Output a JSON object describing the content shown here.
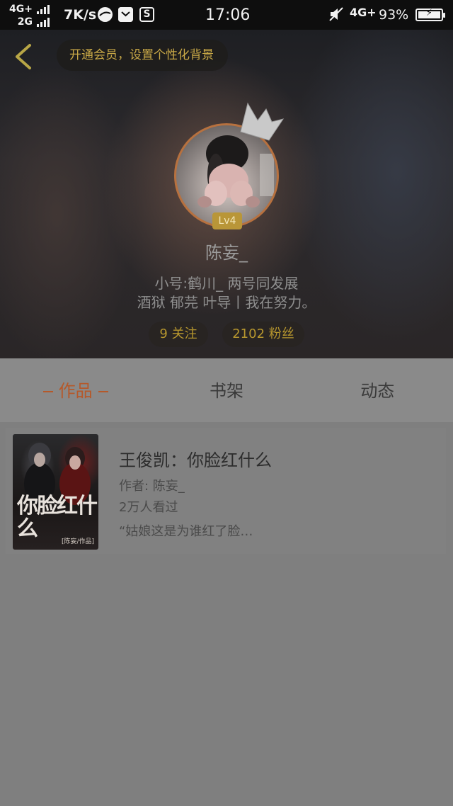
{
  "status_bar": {
    "net1": "4G+",
    "net2": "2G",
    "speed": "7K/s",
    "time": "17:06",
    "net_right": "4G+",
    "battery_pct": "93%",
    "notif_icons": [
      "browser-icon",
      "mail-icon",
      "s-app-icon"
    ],
    "s_glyph": "S"
  },
  "header": {
    "vip_banner": "开通会员，设置个性化背景",
    "level": "Lv4",
    "username": "陈妄_",
    "bio_line1": "小号:鹤川_  两号同发展",
    "bio_line2": "酒狱 郁芫 叶导丨我在努力。",
    "following": "9 关注",
    "fans": "2102 粉丝"
  },
  "tabs": [
    {
      "label": "作品",
      "active": true
    },
    {
      "label": "书架",
      "active": false
    },
    {
      "label": "动态",
      "active": false
    }
  ],
  "work": {
    "title": "王俊凯：你脸红什么",
    "author": "作者: 陈妄_",
    "reads": "2万人看过",
    "excerpt": "“姑娘这是为谁红了脸…",
    "cover_title": "你脸红什么",
    "cover_author": "[陈妄/作品]"
  },
  "colors": {
    "accent_orange": "#b5592a",
    "gold": "#b6962e",
    "avatar_ring": "#b7713f"
  }
}
